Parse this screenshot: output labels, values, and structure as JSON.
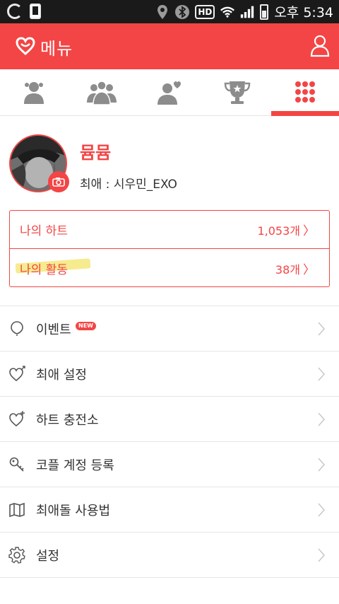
{
  "statusbar": {
    "time": "오후 5:34",
    "hd": "HD"
  },
  "appbar": {
    "title": "메뉴"
  },
  "tabs": [
    {
      "name": "people-tab"
    },
    {
      "name": "groups-tab"
    },
    {
      "name": "fan-tab"
    },
    {
      "name": "trophy-tab"
    },
    {
      "name": "menu-tab",
      "active": true
    }
  ],
  "profile": {
    "name": "뮴뮴",
    "favorite": "최애 : 시우민_EXO"
  },
  "stats": [
    {
      "label": "나의 하트",
      "value": "1,053개"
    },
    {
      "label": "나의 활동",
      "value": "38개"
    }
  ],
  "menu": [
    {
      "label": "이벤트",
      "badge": "NEW",
      "icon": "balloon-icon"
    },
    {
      "label": "최애 설정",
      "icon": "heart-arrow-icon"
    },
    {
      "label": "하트 충전소",
      "icon": "heart-plus-icon"
    },
    {
      "label": "코플 계정 등록",
      "icon": "key-icon"
    },
    {
      "label": "최애돌 사용법",
      "icon": "map-icon"
    },
    {
      "label": "설정",
      "icon": "gear-icon"
    }
  ],
  "colors": {
    "accent": "#f34545",
    "icon_gray": "#8c8c8c"
  }
}
